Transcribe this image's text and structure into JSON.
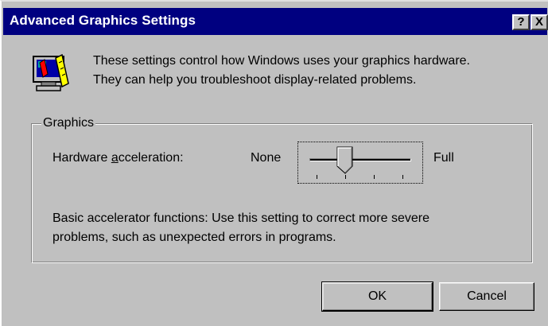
{
  "window": {
    "title": "Advanced Graphics Settings",
    "help_glyph": "?",
    "close_glyph": "X"
  },
  "intro": {
    "icon": "monitor-display-icon",
    "line1": "These settings control how Windows uses your graphics hardware.",
    "line2": "They can help you troubleshoot display-related problems."
  },
  "graphics_group": {
    "label": "Graphics",
    "hardware_acceleration": {
      "label_prefix": "Hardware ",
      "label_accel_key": "a",
      "label_suffix": "cceleration:",
      "min_label": "None",
      "max_label": "Full",
      "tick_count": 4,
      "selected_position": 1
    },
    "description_line1": "Basic accelerator functions: Use this setting to correct more severe",
    "description_line2": "problems, such as unexpected errors in programs."
  },
  "buttons": {
    "ok": "OK",
    "cancel": "Cancel"
  },
  "colors": {
    "titlebar": "#000080",
    "face": "#c0c0c0"
  }
}
